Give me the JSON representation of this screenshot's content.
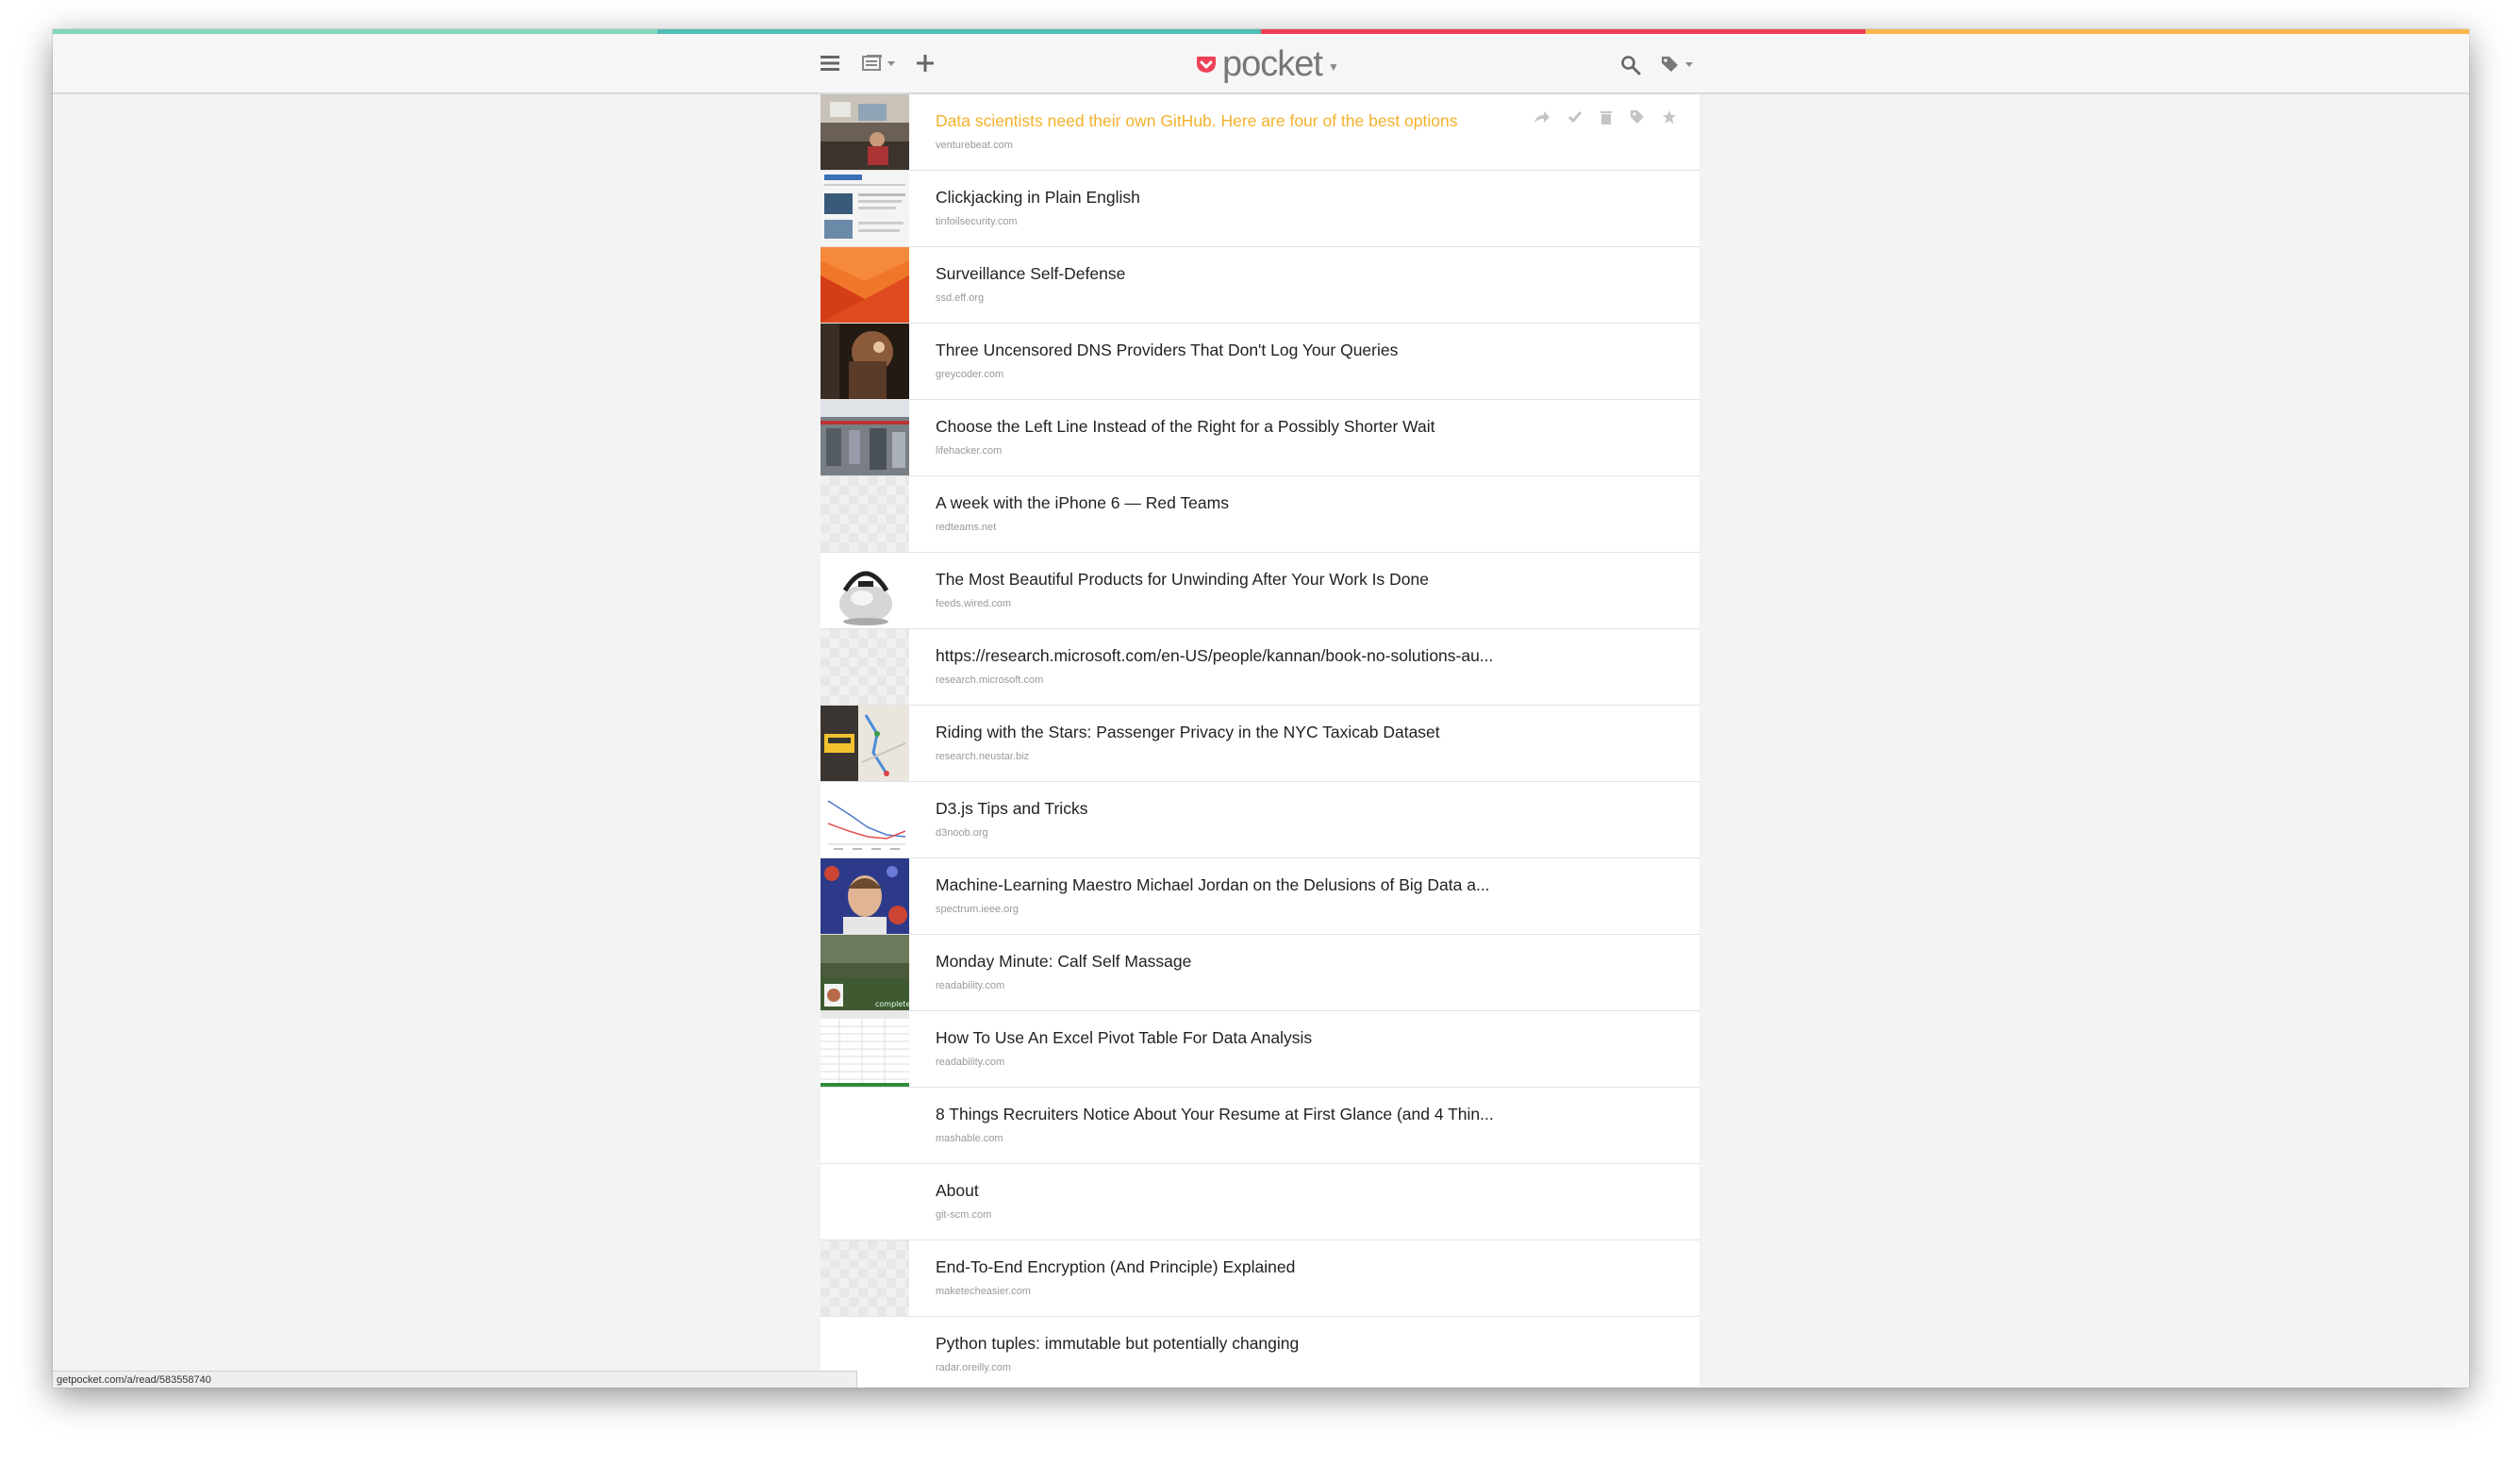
{
  "app": {
    "logo_text": "pocket"
  },
  "colors": {
    "stripe": [
      "#83d6ba",
      "#50bcb6",
      "#ef4056",
      "#fcb64c"
    ],
    "accent_title": "#f3b12a",
    "logo_red": "#ee4056"
  },
  "toolbar": {
    "icons": [
      "menu-icon",
      "list-view-icon",
      "add-icon",
      "search-icon",
      "tag-icon"
    ]
  },
  "items": [
    {
      "title": "Data scientists need their own GitHub. Here are four of the best options",
      "domain": "venturebeat.com",
      "thumb": "photo-office",
      "active": true
    },
    {
      "title": "Clickjacking in Plain English",
      "domain": "tinfoilsecurity.com",
      "thumb": "screenshot-web"
    },
    {
      "title": "Surveillance Self-Defense",
      "domain": "ssd.eff.org",
      "thumb": "orange-graphic"
    },
    {
      "title": "Three Uncensored DNS Providers That Don't Log Your Queries",
      "domain": "greycoder.com",
      "thumb": "photo-dark"
    },
    {
      "title": "Choose the Left Line Instead of the Right for a Possibly Shorter Wait",
      "domain": "lifehacker.com",
      "thumb": "photo-store"
    },
    {
      "title": "A week with the iPhone 6 — Red Teams",
      "domain": "redteams.net",
      "thumb": "placeholder"
    },
    {
      "title": "The Most Beautiful Products for Unwinding After Your Work Is Done",
      "domain": "feeds.wired.com",
      "thumb": "kettle"
    },
    {
      "title": "https://research.microsoft.com/en-US/people/kannan/book-no-solutions-au...",
      "domain": "research.microsoft.com",
      "thumb": "placeholder"
    },
    {
      "title": "Riding with the Stars: Passenger Privacy in the NYC Taxicab Dataset",
      "domain": "research.neustar.biz",
      "thumb": "taxi-map"
    },
    {
      "title": "D3.js Tips and Tricks",
      "domain": "d3noob.org",
      "thumb": "line-chart"
    },
    {
      "title": "Machine-Learning Maestro Michael Jordan on the Delusions of Big Data a...",
      "domain": "spectrum.ieee.org",
      "thumb": "portrait"
    },
    {
      "title": "Monday Minute: Calf Self Massage",
      "domain": "readability.com",
      "thumb": "field-photo"
    },
    {
      "title": "How To Use An Excel Pivot Table For Data Analysis",
      "domain": "readability.com",
      "thumb": "spreadsheet"
    },
    {
      "title": "8 Things Recruiters Notice About Your Resume at First Glance (and 4 Thin...",
      "domain": "mashable.com",
      "thumb": "blank"
    },
    {
      "title": "About",
      "domain": "git-scm.com",
      "thumb": "blank"
    },
    {
      "title": "End-To-End Encryption (And Principle) Explained",
      "domain": "maketecheasier.com",
      "thumb": "placeholder"
    },
    {
      "title": "Python tuples: immutable but potentially changing",
      "domain": "radar.oreilly.com",
      "thumb": "blank"
    }
  ],
  "statusbar": {
    "url": "getpocket.com/a/read/583558740"
  }
}
